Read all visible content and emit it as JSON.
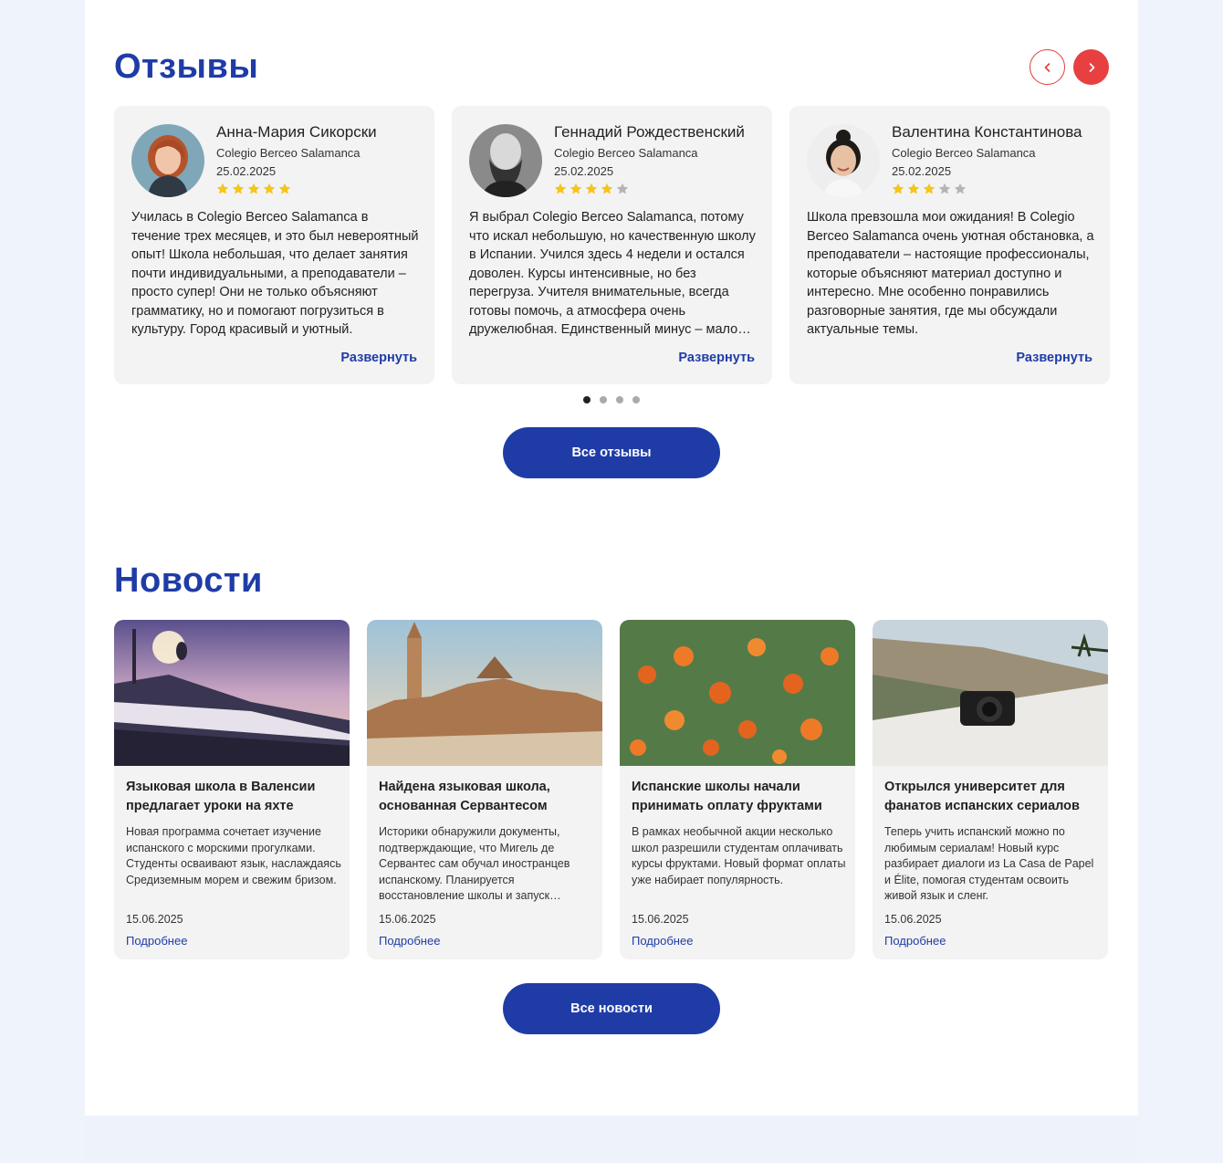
{
  "reviews": {
    "title": "Отзывы",
    "prev_icon": "chevron-left-icon",
    "next_icon": "chevron-right-icon",
    "accent_color": "#e84040",
    "items": [
      {
        "name": "Анна-Мария Сикорски",
        "school": "Colegio Berceo Salamanca",
        "date": "25.02.2025",
        "rating": 5,
        "text": "Училась в Colegio Berceo Salamanca в течение трех месяцев, и это был невероятный опыт! Школа небольшая, что делает занятия почти индивидуальными, а преподаватели – просто супер! Они не только объясняют грамматику, но и помогают погрузиться в культуру. Город красивый и уютный.",
        "more": "Развернуть"
      },
      {
        "name": "Геннадий Рождественский",
        "school": "Colegio Berceo Salamanca",
        "date": "25.02.2025",
        "rating": 4,
        "text": "Я выбрал Colegio Berceo Salamanca, потому что искал небольшую, но качественную школу в Испании. Учился здесь 4 недели и остался доволен. Курсы интенсивные, но без перегруза. Учителя внимательные, всегда готовы помочь, а атмосфера очень дружелюбная. Единственный минус – мало свободного времени.",
        "more": "Развернуть"
      },
      {
        "name": "Валентина Константинова",
        "school": "Colegio Berceo Salamanca",
        "date": "25.02.2025",
        "rating": 3,
        "text": "Школа превзошла мои ожидания! В Colegio Berceo Salamanca очень уютная обстановка, а преподаватели – настоящие профессионалы, которые объясняют материал доступно и интересно. Мне особенно понравились разговорные занятия, где мы обсуждали актуальные темы.",
        "more": "Развернуть"
      }
    ],
    "pagination": {
      "pages": 4,
      "active": 1
    },
    "all_button": "Все отзывы"
  },
  "news": {
    "title": "Новости",
    "items": [
      {
        "title": "Языковая школа в Валенсии предлагает уроки на яхте",
        "text": "Новая программа сочетает изучение испанского с морскими прогулками. Студенты осваивают язык, наслаждаясь Средиземным морем и свежим бризом.",
        "date": "15.06.2025",
        "more": "Подробнее",
        "image": "yacht-image"
      },
      {
        "title": "Найдена языковая школа, основанная Сервантесом",
        "text": "Историки обнаружили документы, подтверждающие, что Мигель де Сервантес сам обучал иностранцев испанскому. Планируется восстановление школы и запуск экскурсий.",
        "date": "15.06.2025",
        "more": "Подробнее",
        "image": "seville-cathedral-image"
      },
      {
        "title": "Испанские школы начали принимать оплату фруктами",
        "text": "В рамках необычной акции несколько школ разрешили студентам оплачивать курсы фруктами. Новый формат оплаты уже набирает популярность.",
        "date": "15.06.2025",
        "more": "Подробнее",
        "image": "orange-tree-image"
      },
      {
        "title": "Открылся университет для фанатов испанских сериалов",
        "text": "Теперь учить испанский можно по любимым сериалам! Новый курс разбирает диалоги из La Casa de Papel и Élite, помогая студентам освоить живой язык и сленг.",
        "date": "15.06.2025",
        "more": "Подробнее",
        "image": "camera-coast-image"
      }
    ],
    "all_button": "Все новости"
  }
}
